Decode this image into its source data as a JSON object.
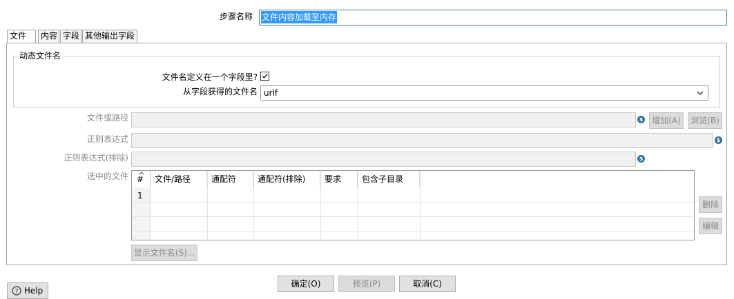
{
  "step_name": {
    "label": "步骤名称",
    "value": "文件内容加载至内存"
  },
  "tabs": [
    {
      "label": "文件",
      "active": true
    },
    {
      "label": "内容",
      "active": false
    },
    {
      "label": "字段",
      "active": false
    },
    {
      "label": "其他输出字段",
      "active": false
    }
  ],
  "dynamic_group": {
    "title": "动态文件名",
    "filename_in_field_label": "文件名定义在一个字段里?",
    "filename_in_field_checked": true,
    "filename_from_field_label": "从字段获得的文件名",
    "filename_from_field_value": "urlf"
  },
  "file_or_path_label": "文件或路径",
  "add_button": "增加(A)",
  "browse_button": "浏览(B)",
  "regex_label": "正则表达式",
  "regex_exclude_label": "正则表达式(排除)",
  "selected_files": {
    "label": "选中的文件",
    "columns": [
      "#",
      "文件/路径",
      "通配符",
      "通配符(排除)",
      "要求",
      "包含子目录"
    ],
    "rows": [
      {
        "index": "1"
      }
    ]
  },
  "delete_button": "删除",
  "edit_button": "编辑",
  "show_filenames_button": "显示文件名(S)...",
  "footer": {
    "help_label": "Help",
    "ok_label": "确定(O)",
    "preview_label": "预览(P)",
    "cancel_label": "取消(C)"
  },
  "icons": {
    "variable": "dollar-variable-icon",
    "check": "check-icon",
    "dropdown": "chevron-down-icon",
    "help": "question-circle-icon"
  }
}
